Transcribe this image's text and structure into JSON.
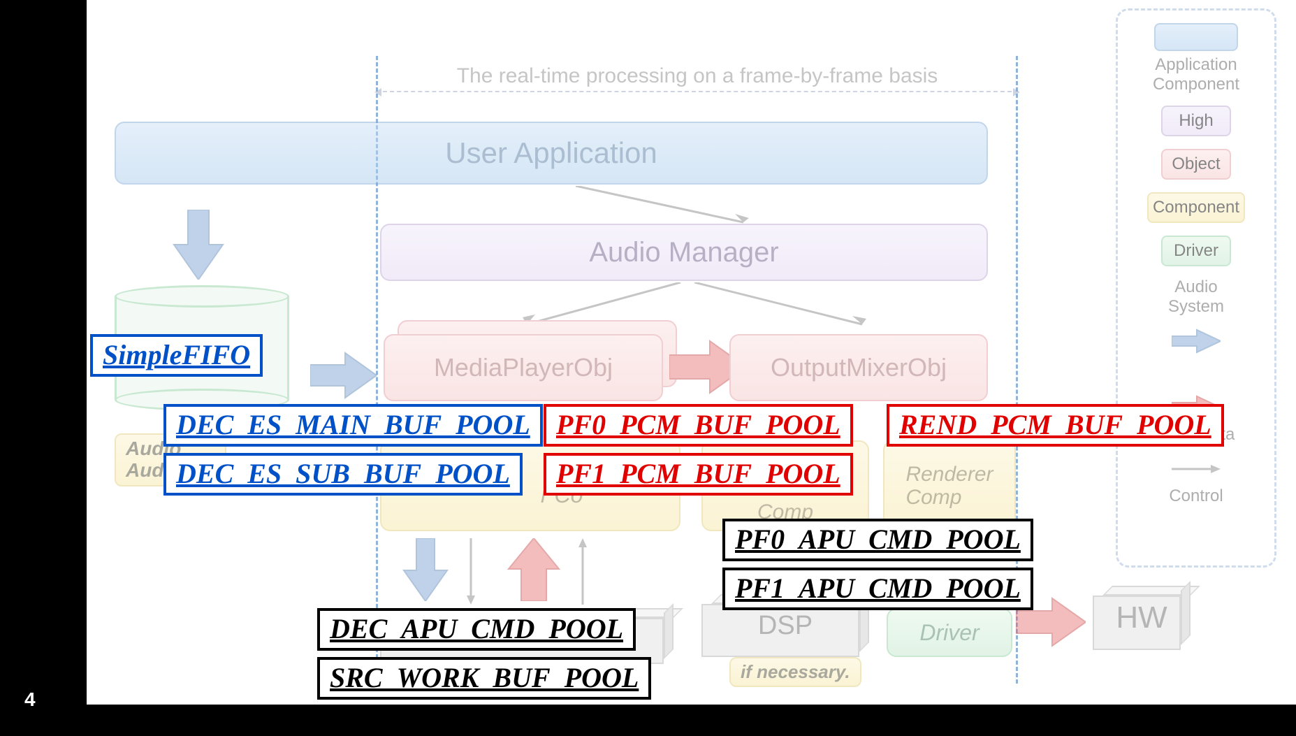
{
  "page_number": "4",
  "span_title": "The real-time processing on a frame-by-frame basis",
  "boxes": {
    "user_app": "User Application",
    "audio_manager": "Audio Manager",
    "media_player_obj": "MediaPlayerObj",
    "output_mixer_obj": "OutputMixerObj",
    "renderer_comp": "Renderer\nComp",
    "driver": "Driver",
    "dsp": "DSP",
    "hw": "HW",
    "comp_small": "Comp",
    "if_necessary": "if necessary.",
    "audio_frag": "Audio\nAudio",
    "r_co_frag": "r Co"
  },
  "legend": {
    "app_comp": "Application\nComponent",
    "high": "High",
    "object": "Object",
    "component": "Component",
    "driver": "Driver",
    "audio_system": "Audio\nSystem",
    "pcm_data": "PCM Data",
    "control": "Control"
  },
  "pools": {
    "simple_fifo": "SimpleFIFO",
    "dec_es_main": "DEC_ES_MAIN_BUF_POOL",
    "dec_es_sub": "DEC_ES_SUB_BUF_POOL",
    "pf0_pcm": "PF0_PCM_BUF_POOL",
    "pf1_pcm": "PF1_PCM_BUF_POOL",
    "rend_pcm": "REND_PCM_BUF_POOL",
    "pf0_apu": "PF0_APU_CMD_POOL",
    "pf1_apu": "PF1_APU_CMD_POOL",
    "dec_apu": "DEC_APU_CMD_POOL",
    "src_work": "SRC_WORK_BUF_POOL"
  }
}
